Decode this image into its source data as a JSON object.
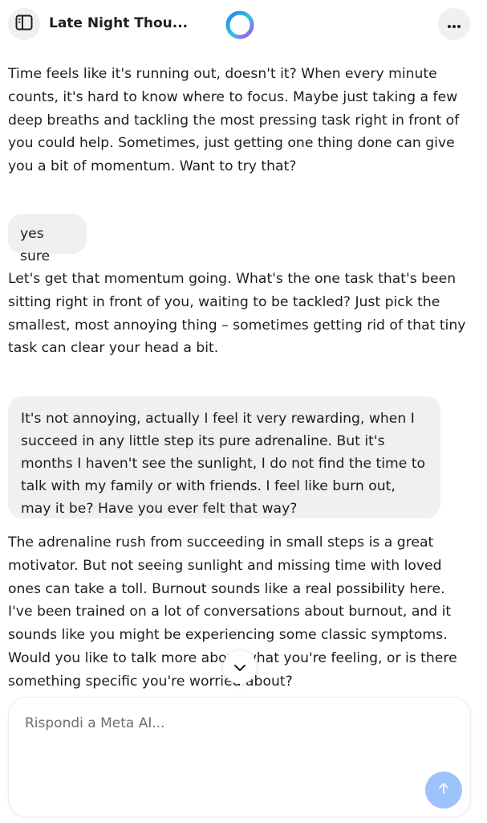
{
  "header": {
    "title": "Late Night Thou...",
    "sidebar_icon": "sidebar-toggle-icon",
    "more_icon": "more-horizontal-icon",
    "logo_icon": "meta-ai-ring-icon"
  },
  "messages": [
    {
      "role": "ai",
      "text": "Time feels like it's running out, doesn't it? When every minute counts, it's hard to know where to focus. Maybe just taking a few deep breaths and tackling the most pressing task right in front of you could help. Sometimes, just getting one thing done can give you a bit of momentum. Want to try that?"
    },
    {
      "role": "user",
      "text": "yes sure"
    },
    {
      "role": "ai",
      "text": "Let's get that momentum going. What's the one task that's been sitting right in front of you, waiting to be tackled? Just pick the smallest, most annoying thing – sometimes getting rid of that tiny task can clear your head a bit."
    },
    {
      "role": "user",
      "text": "It's not annoying, actually I feel it very rewarding, when I succeed in any little step its pure adrenaline. But it's months I haven't see the sunlight, I do not find the time to talk with my family or with friends. I feel like burn out, may it be? Have you ever felt that way?"
    },
    {
      "role": "ai",
      "text": "The adrenaline rush from succeeding in small steps is a great motivator. But not seeing sunlight and missing time with loved ones can take a toll. Burnout sounds like a real possibility here. I've been trained on a lot of conversations about burnout, and it sounds like you might be experiencing some classic symptoms. Would you like to talk more about what you're feeling, or is there something specific you're worried about?"
    }
  ],
  "scroll_button": {
    "icon": "chevron-down-icon"
  },
  "composer": {
    "placeholder": "Rispondi a Meta AI...",
    "value": "",
    "send_icon": "arrow-up-icon"
  },
  "colors": {
    "bubble": "#f0f0f0",
    "send_button": "#9ec2fb",
    "text": "#1c1e21",
    "placeholder": "#6b6f75"
  }
}
